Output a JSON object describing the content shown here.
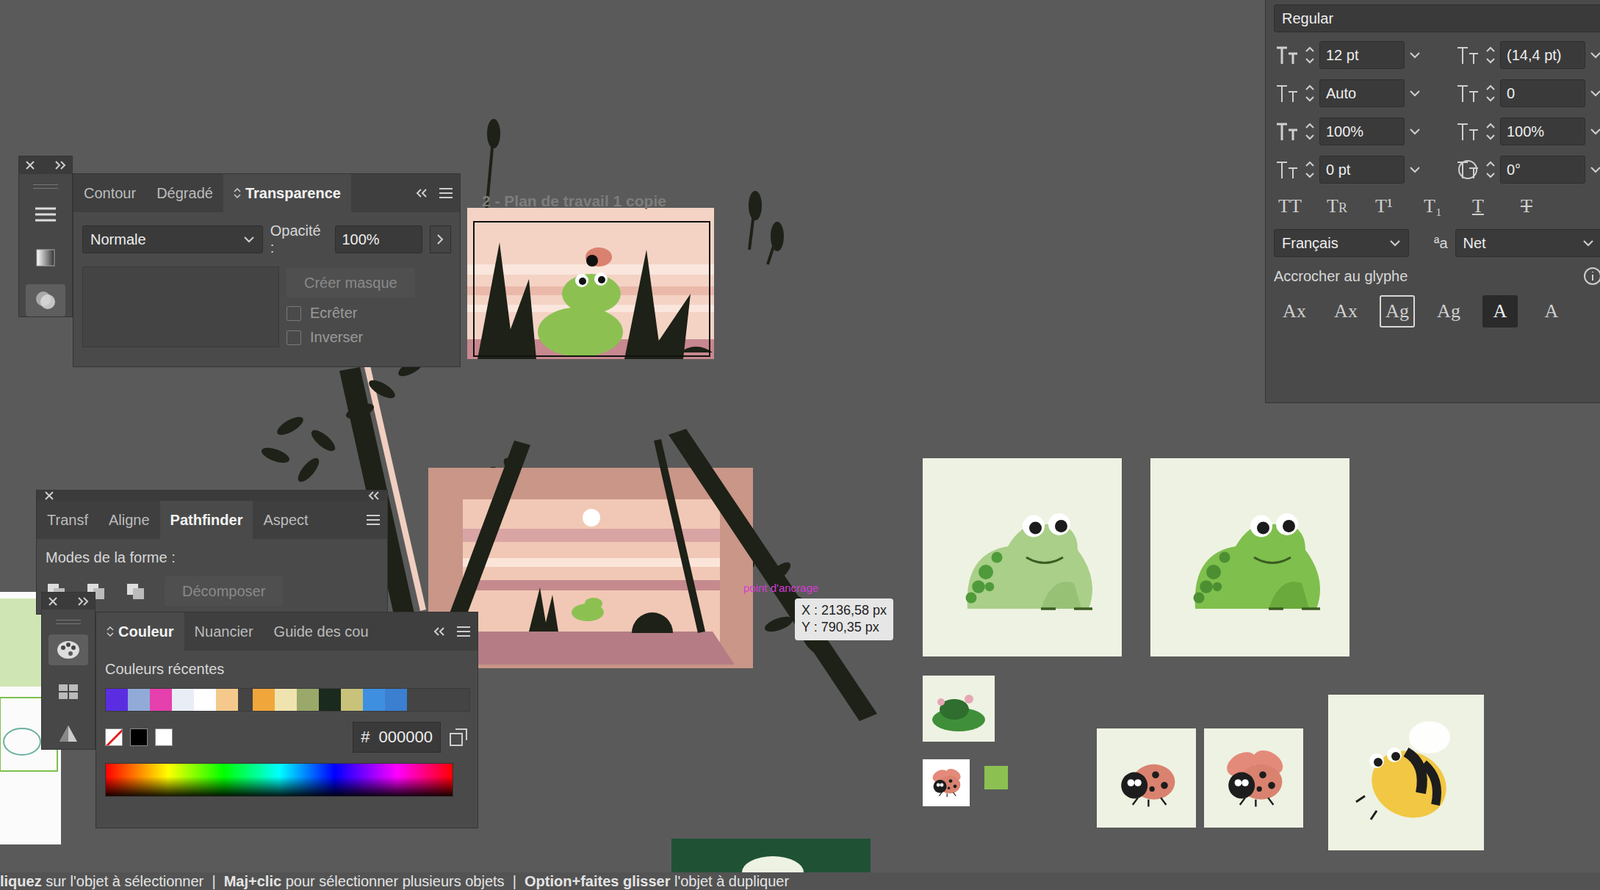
{
  "transparency_panel": {
    "tabs": [
      {
        "label": "Contour",
        "selected": false
      },
      {
        "label": "Dégradé",
        "selected": false
      },
      {
        "label": "Transparence",
        "selected": true
      }
    ],
    "blend_mode": "Normale",
    "opacity_label": "Opacité :",
    "opacity": "100%",
    "mask_button": {
      "label": "Créer masque",
      "disabled": true
    },
    "options": [
      {
        "label": "Ecrêter",
        "checked": false
      },
      {
        "label": "Inverser",
        "checked": false
      }
    ]
  },
  "pathfinder_panel": {
    "tabs": [
      {
        "label": "Transf",
        "selected": false
      },
      {
        "label": "Aligne",
        "selected": false
      },
      {
        "label": "Pathfinder",
        "selected": true
      },
      {
        "label": "Aspect",
        "selected": false
      }
    ],
    "shape_modes_label": "Modes de la forme :",
    "expand_button": {
      "label": "Décomposer",
      "disabled": true
    }
  },
  "color_panel": {
    "tabs": [
      {
        "label": "Couleur",
        "selected": true
      },
      {
        "label": "Nuancier",
        "selected": false
      },
      {
        "label": "Guide des cou",
        "selected": false
      }
    ],
    "recent_label": "Couleurs récentes",
    "recent_colors": [
      {
        "color": "#5a2ee0"
      },
      {
        "color": "#92aad8"
      },
      {
        "color": "#e63fae"
      },
      {
        "color": "#e9edf5"
      },
      {
        "color": "#ffffff"
      },
      {
        "color": "#f5c98c"
      },
      {
        "color": "#f0a63a"
      },
      {
        "color": "#efe3b0"
      },
      {
        "color": "#9aa86a"
      },
      {
        "color": "#1b2a1f"
      },
      {
        "color": "#c8c27a"
      },
      {
        "color": "#3f8fe0"
      },
      {
        "color": "#3a7fd0"
      }
    ],
    "hex_prefix": "#",
    "hex": "000000"
  },
  "character_panel": {
    "font_style": "Regular",
    "fields": [
      {
        "value": "12 pt",
        "kind": "size"
      },
      {
        "value": "(14,4 pt)",
        "kind": "leading"
      },
      {
        "value": "Auto",
        "kind": "kerning"
      },
      {
        "value": "0",
        "kind": "tracking"
      },
      {
        "value": "100%",
        "kind": "vscale"
      },
      {
        "value": "100%",
        "kind": "hscale"
      },
      {
        "value": "0 pt",
        "kind": "baseline"
      },
      {
        "value": "0°",
        "kind": "rotation"
      }
    ],
    "style_buttons": [
      {
        "label": "TT",
        "kind": "caps"
      },
      {
        "label": "Tr",
        "kind": "small-caps"
      },
      {
        "label": "T¹",
        "kind": "superscript"
      },
      {
        "label": "T₁",
        "kind": "subscript"
      },
      {
        "label": "T",
        "kind": "underline"
      },
      {
        "label": "T",
        "kind": "strikethrough"
      }
    ],
    "language": "Français",
    "antialias_prefix": "ªa",
    "antialias": "Net",
    "snap_label": "Accrocher au glyphe",
    "snap_buttons": [
      {
        "label": "Ax",
        "kind": "baseline",
        "selected": false
      },
      {
        "label": "Ax",
        "kind": "x-height",
        "selected": false
      },
      {
        "label": "Ag",
        "kind": "bounds",
        "selected": true
      },
      {
        "label": "Ag",
        "kind": "descender",
        "selected": false
      },
      {
        "label": "A",
        "kind": "proximity",
        "selected": true
      },
      {
        "label": "A",
        "kind": "angular",
        "selected": false
      }
    ]
  },
  "canvas": {
    "artboard_label": "2 - Plan de travail 1 copie",
    "anchor_hint": "point d'ancrage",
    "tooltip": {
      "x": "X : 2136,58 px",
      "y": "Y : 790,35 px"
    }
  },
  "status_bar": [
    {
      "text": "liquez",
      "bold": true
    },
    {
      "text": " sur l'objet à sélectionner  |  ",
      "bold": false
    },
    {
      "text": "Maj+clic",
      "bold": true
    },
    {
      "text": " pour sélectionner plusieurs objets  |  ",
      "bold": false
    },
    {
      "text": "Option+faites glisser",
      "bold": true
    },
    {
      "text": " l'objet à dupliquer",
      "bold": false
    }
  ]
}
